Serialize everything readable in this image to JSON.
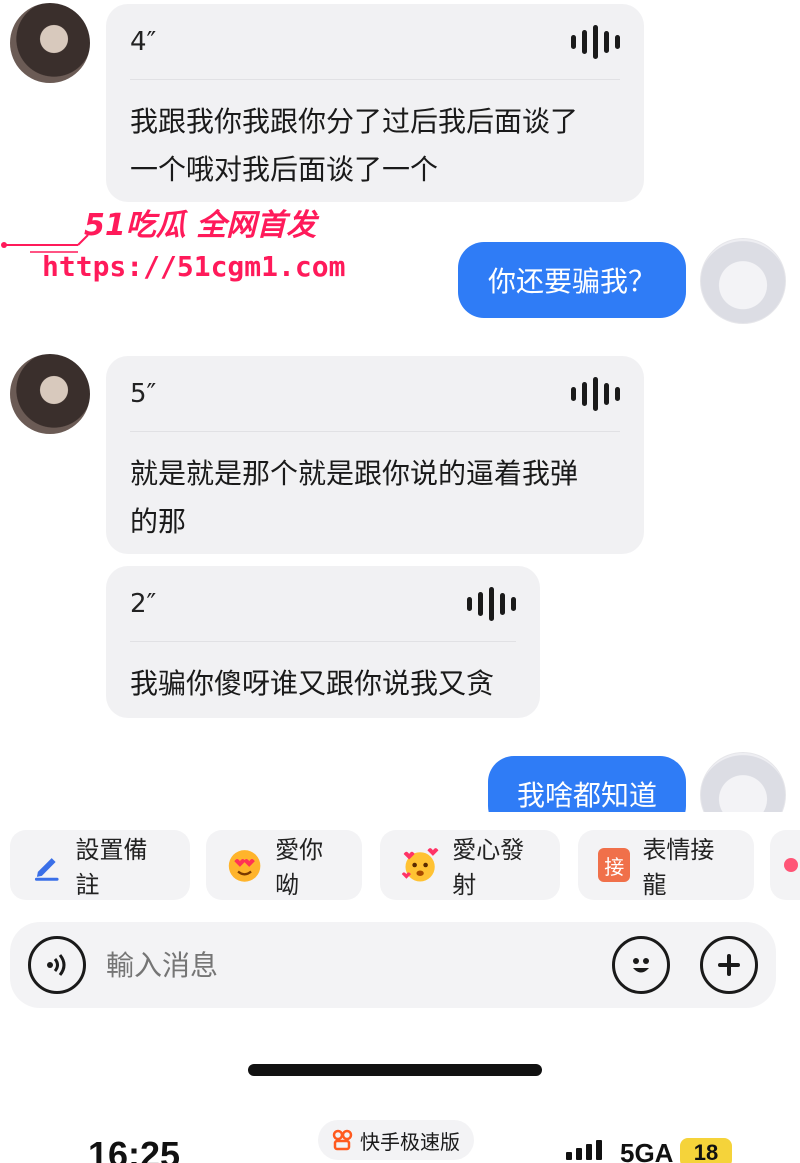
{
  "messages": [
    {
      "duration": "4″",
      "transcript_lines": [
        "我跟我你我跟你分了过后我后面谈了",
        "一个哦对我后面谈了一个"
      ]
    },
    {
      "outgoing": "你还要骗我？"
    },
    {
      "duration": "5″",
      "transcript_lines": [
        "就是就是那个就是跟你说的逼着我弹",
        "的那"
      ]
    },
    {
      "duration": "2″",
      "transcript_lines": [
        "我骗你傻呀谁又跟你说我又贪"
      ]
    },
    {
      "outgoing": "我啥都知道"
    }
  ],
  "watermark": {
    "title": "51吃瓜 全网首发",
    "url": "https://51cgm1.com"
  },
  "chips": [
    {
      "icon": "pencil-icon",
      "label": "設置備註"
    },
    {
      "icon": "love-eyes-emoji-icon",
      "label": "愛你呦"
    },
    {
      "icon": "heart-burst-emoji-icon",
      "label": "愛心發射"
    },
    {
      "icon": "jie-badge-icon",
      "badge": "接",
      "label": "表情接龍"
    }
  ],
  "input": {
    "placeholder": "輸入消息"
  },
  "status_bar": {
    "app_name": "快手极速版",
    "time": "16:25",
    "network": "5GA",
    "battery": "18"
  },
  "colors": {
    "accent": "#2f7cf6",
    "watermark": "#ff1a5a"
  }
}
